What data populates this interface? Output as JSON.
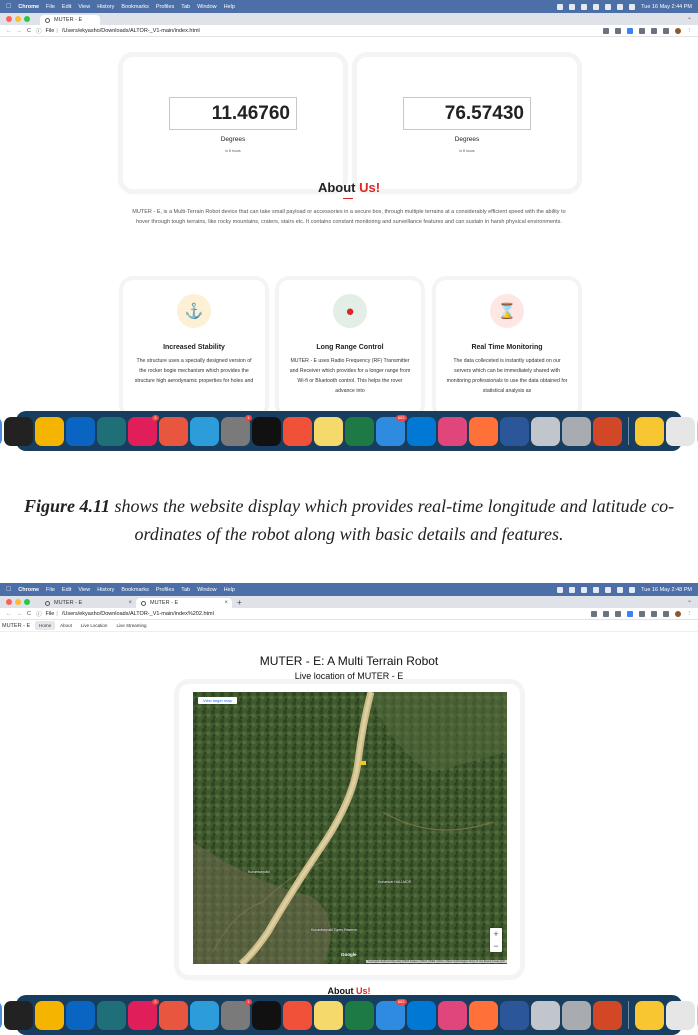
{
  "menubar": {
    "app": "Chrome",
    "items": [
      "File",
      "Edit",
      "View",
      "History",
      "Bookmarks",
      "Profiles",
      "Tab",
      "Window",
      "Help"
    ],
    "clock1": "Tue 16 May  2:44 PM",
    "clock2": "Tue 16 May  2:48 PM"
  },
  "browser1": {
    "tab_title": "MUTER - E",
    "url_prefix": "File",
    "url": "/Users/ekyasho/Downloads/ALTOR-_V1-main/index.html"
  },
  "browser2": {
    "tab1_title": "MUTER - E",
    "tab2_title": "MUTER - E",
    "url_prefix": "File",
    "url": "/Users/ekyasho/Downloads/ALTOR-_V1-main/index%202.html"
  },
  "coordinates": [
    {
      "value": "11.46760",
      "unit": "Degrees",
      "sub": "in 8 hours"
    },
    {
      "value": "76.57430",
      "unit": "Degrees",
      "sub": "in 8 hours"
    }
  ],
  "about": {
    "title_main": "About ",
    "title_accent": "Us!",
    "text": "MUTER - E, is a Multi-Terrain Robot device that can take small payload or accessories in a secure box, through multiple terrains at a considerably efficient speed with the ability to hover through tough terrains, like rocky mountains, craters, stairs etc. It contains constant monitoring and surveillance features and can sustain in harsh physical environments."
  },
  "features": [
    {
      "title": "Increased Stability",
      "icon": "anchor-icon",
      "text": "The structure uses a specially designed version of the rocker bogie mechanism which provides the structure high aerodynamic properties for holes and"
    },
    {
      "title": "Long Range Control",
      "icon": "globe-icon",
      "text": "MUTER - E uses Radio Frequency (RF) Transmitter and Receiver which provides for a longer range from Wi-fi or Bluetooth control. This helps the rover advance into"
    },
    {
      "title": "Real Time Monitoring",
      "icon": "hourglass-icon",
      "text": "The data colleceted is instantly updated on our servers which can be immediately shared with monitoring professionals to use the data obtained for statistical analysis as"
    }
  ],
  "caption": {
    "figure": "Figure 4.11",
    "text": " shows the website display which provides real-time longitude and latitude co-ordinates of the robot along with basic details and features."
  },
  "page2": {
    "nav_brand": "MUTER - E",
    "nav_links": [
      "Home",
      "About",
      "Live Location",
      "Live Streaming"
    ],
    "title": "MUTER - E: A Multi Terrain Robot",
    "subtitle": "Live location of MUTER - E",
    "map_button": "View larger map",
    "map_google": "Google",
    "map_footer": "Keyboard shortcuts   Map data ©2023 Imagery ©2023, CNES / Airbus, Maxar Technologies   Terms of Use   Report a map error",
    "about_main": "About ",
    "about_accent": "Us!"
  },
  "colors": {
    "accent_red": "#dc2626",
    "menubar_blue": "#4c6fa8",
    "dock_navy": "#173d5f"
  },
  "dock_icons": [
    "finder-icon",
    "amazon-icon",
    "chrome-icon",
    "outlook-icon",
    "perplexity-icon",
    "slack-icon",
    "tasks-icon",
    "safari-icon",
    "system-preferences-icon",
    "terminal-icon",
    "swift-icon",
    "notes-icon",
    "excel-icon",
    "mail-icon",
    "vscode-icon",
    "intellij-icon",
    "firefox-icon",
    "word-icon",
    "preview-icon",
    "font-book-icon",
    "powerpoint-icon",
    "mascot-icon",
    "file-icon",
    "trash-icon"
  ],
  "dock_badges": {
    "slack-icon": "3",
    "system-preferences-icon": "1",
    "mail-icon": "602"
  }
}
